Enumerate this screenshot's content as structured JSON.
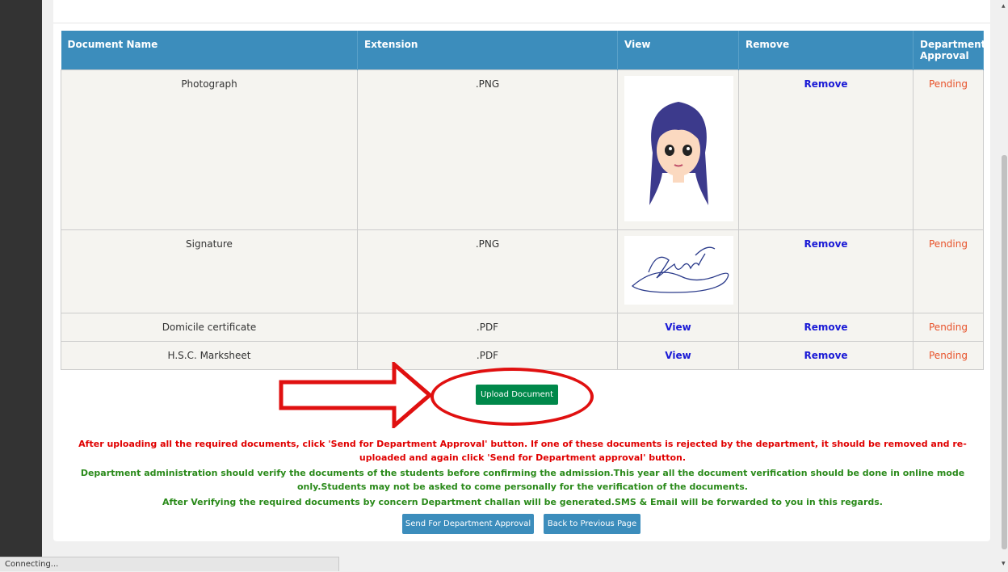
{
  "table": {
    "headers": [
      "Document Name",
      "Extension",
      "View",
      "Remove",
      "Department Approval"
    ],
    "rows": [
      {
        "name": "Photograph",
        "ext": ".PNG",
        "view": "",
        "remove": "Remove",
        "status": "Pending"
      },
      {
        "name": "Signature",
        "ext": ".PNG",
        "view": "",
        "remove": "Remove",
        "status": "Pending"
      },
      {
        "name": "Domicile certificate",
        "ext": ".PDF",
        "view": "View",
        "remove": "Remove",
        "status": "Pending"
      },
      {
        "name": "H.S.C. Marksheet",
        "ext": ".PDF",
        "view": "View",
        "remove": "Remove",
        "status": "Pending"
      }
    ]
  },
  "upload_button": "Upload Document",
  "notes": {
    "red": "After uploading all the required documents, click 'Send for Department Approval' button. If one of these documents is rejected by the department, it should be removed and re-uploaded and again click 'Send for Department approval' button.",
    "green1": "Department administration should verify the documents of the students before confirming the admission.This year all the document verification should be done in online mode only.Students may not be asked to come personally for the verification of the documents.",
    "green2": "After Verifying the required documents by concern Department challan will be generated.SMS & Email will be forwarded to you in this regards."
  },
  "buttons": {
    "send": "Send For Department Approval",
    "back": "Back to Previous Page"
  },
  "status_bar": "Connecting...",
  "colors": {
    "header": "#3c8dbc",
    "upload": "#00884a",
    "pending": "#e8522a",
    "link": "#1a1ad6",
    "annotation": "#e01010"
  }
}
